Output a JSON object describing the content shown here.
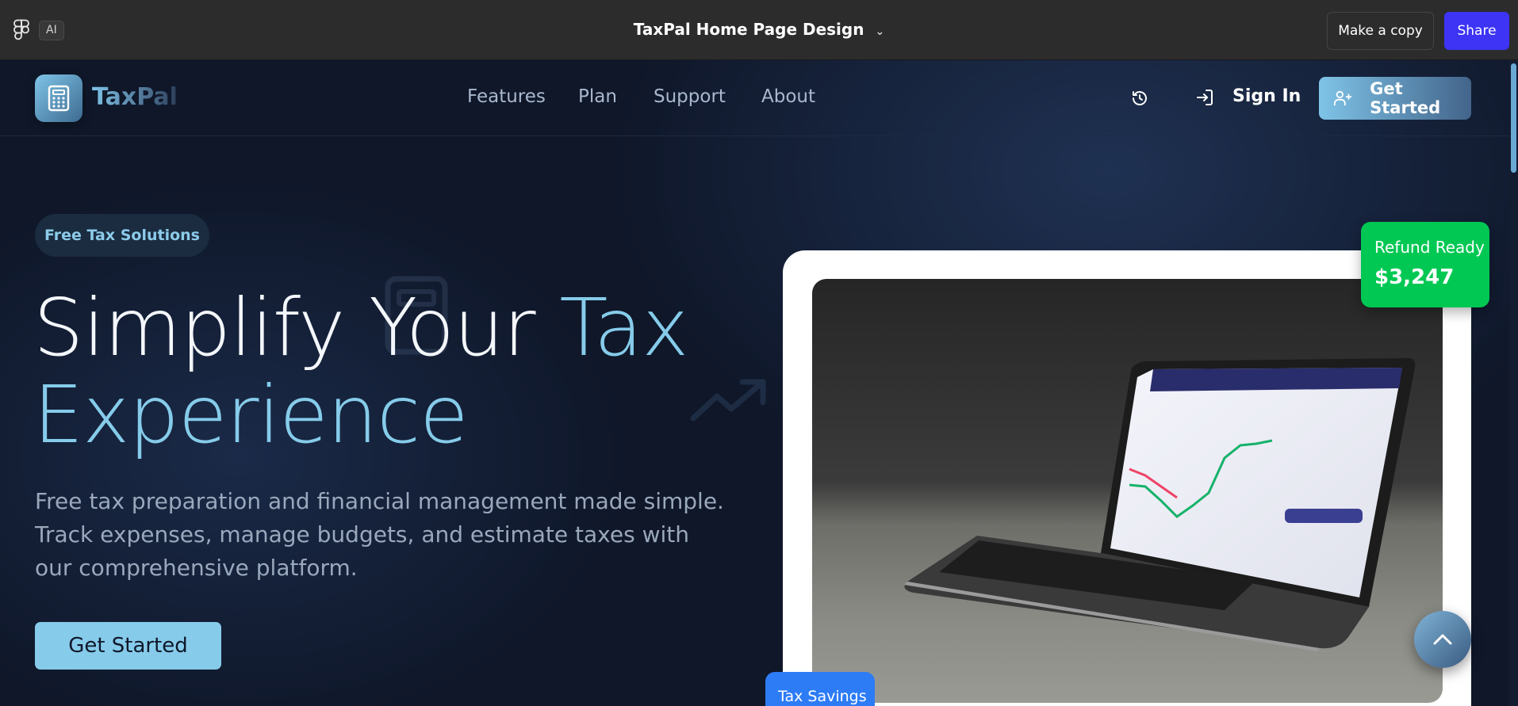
{
  "figma": {
    "ai_label": "AI",
    "file_title": "TaxPal Home Page Design",
    "make_copy_label": "Make a copy",
    "share_label": "Share"
  },
  "site": {
    "brand": "TaxPal",
    "nav": [
      "Features",
      "Plan",
      "Support",
      "About"
    ],
    "sign_in": "Sign In",
    "get_started": "Get Started"
  },
  "hero": {
    "pill": "Free Tax Solutions",
    "title_part1": "Simplify Your ",
    "title_accent1": "Tax",
    "title_accent2": "Experience",
    "subtitle": "Free tax preparation and financial management made simple. Track expenses, manage budgets, and estimate taxes with our comprehensive platform.",
    "cta": "Get Started"
  },
  "cards": {
    "refund_label": "Refund Ready",
    "refund_amount": "$3,247",
    "savings_label": "Tax Savings"
  },
  "icons": {
    "figma": "figma-icon",
    "history": "history-icon",
    "sign_in": "sign-in-icon",
    "add_user": "user-plus-icon",
    "calculator": "calculator-icon",
    "trend": "trending-up-icon",
    "scroll_top": "chevron-up-icon"
  },
  "colors": {
    "accent": "#86cbea",
    "share": "#3d34f5",
    "refund": "#00c853",
    "savings": "#2d7cf6"
  }
}
